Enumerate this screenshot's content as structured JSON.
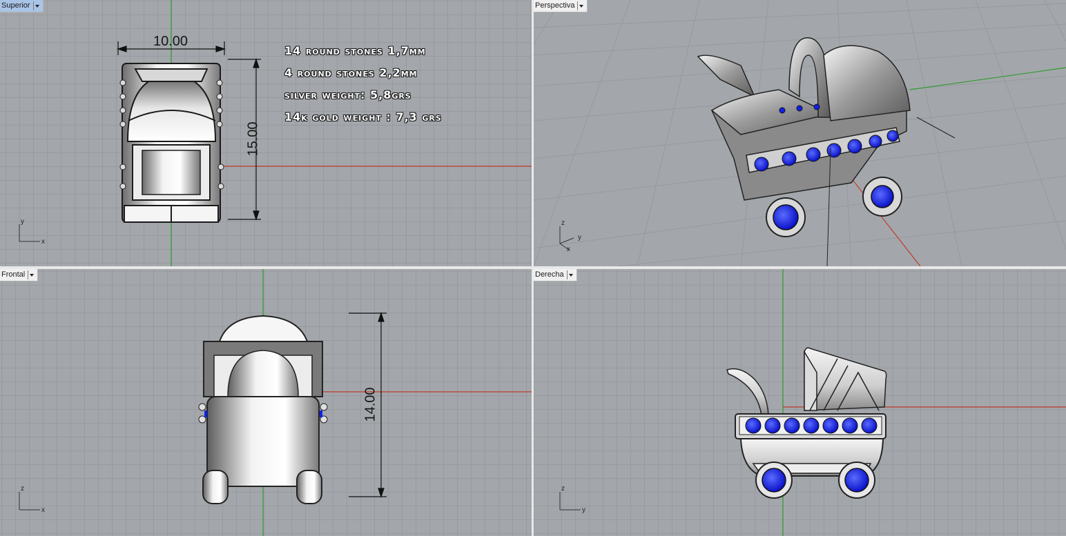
{
  "viewports": {
    "top": {
      "label": "Superior"
    },
    "perspective": {
      "label": "Perspectiva"
    },
    "front": {
      "label": "Frontal"
    },
    "right": {
      "label": "Derecha"
    }
  },
  "notes": [
    "14 round stones 1,7mm",
    "4 round stones 2,2mm",
    "silver weight: 5,8grs",
    "14k gold weight : 7,3 grs"
  ],
  "dimensions": {
    "top_width": "10.00",
    "top_height": "15.00",
    "front_height": "14.00"
  },
  "axes": {
    "top": [
      "y",
      "x"
    ],
    "perspective": [
      "z",
      "y",
      "x"
    ],
    "front": [
      "z",
      "x"
    ],
    "right": [
      "z",
      "y"
    ]
  },
  "colors": {
    "grid_background": "#a3a7ab",
    "x_axis": "#c0392b",
    "y_axis": "#2e9b2e",
    "stone_blue": "#1020e8",
    "active_tab": "#a9c4e6"
  }
}
